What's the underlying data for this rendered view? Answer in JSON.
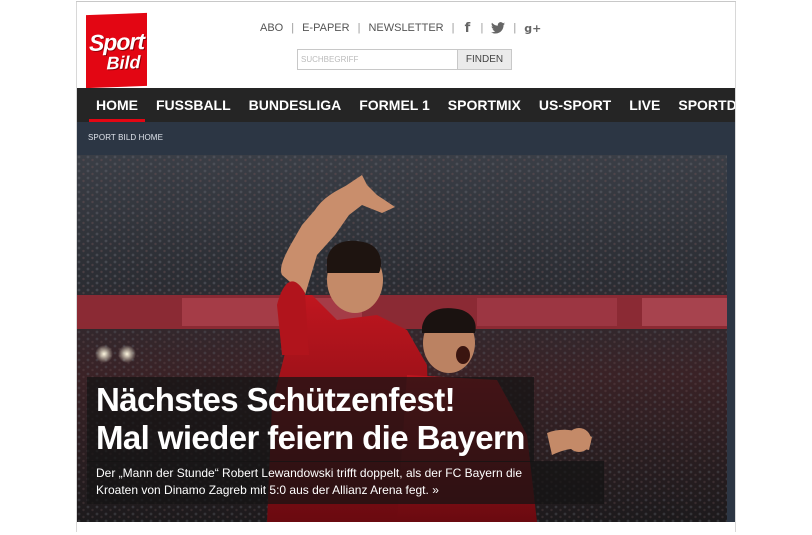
{
  "brand": {
    "logo_line1": "Sport",
    "logo_line2": "Bild",
    "logo_color": "#e30613"
  },
  "toplinks": [
    {
      "label": "ABO"
    },
    {
      "label": "E-PAPER"
    },
    {
      "label": "NEWSLETTER"
    }
  ],
  "social": {
    "facebook": "f",
    "twitter": "twitter-icon",
    "googleplus": "g+"
  },
  "search": {
    "placeholder": "SUCHBEGRIFF",
    "button_label": "FINDEN"
  },
  "nav": {
    "items": [
      "HOME",
      "FUSSBALL",
      "BUNDESLIGA",
      "FORMEL 1",
      "SPORTMIX",
      "US-SPORT",
      "LIVE",
      "SPORTDATEN"
    ],
    "active": "HOME",
    "background": "#252525",
    "active_color": "#e30613"
  },
  "breadcrumb": {
    "label": "SPORT BILD HOME"
  },
  "hero": {
    "headline_line1": "Nächstes Schützenfest!",
    "headline_line2": "Mal wieder feiern die Bayern",
    "teaser_line1": "Der „Mann der Stunde“ Robert Lewandowski trifft doppelt, als der FC Bayern die",
    "teaser_line2": "Kroaten von Dinamo Zagreb mit 5:0 aus der Allianz Arena fegt. »"
  }
}
